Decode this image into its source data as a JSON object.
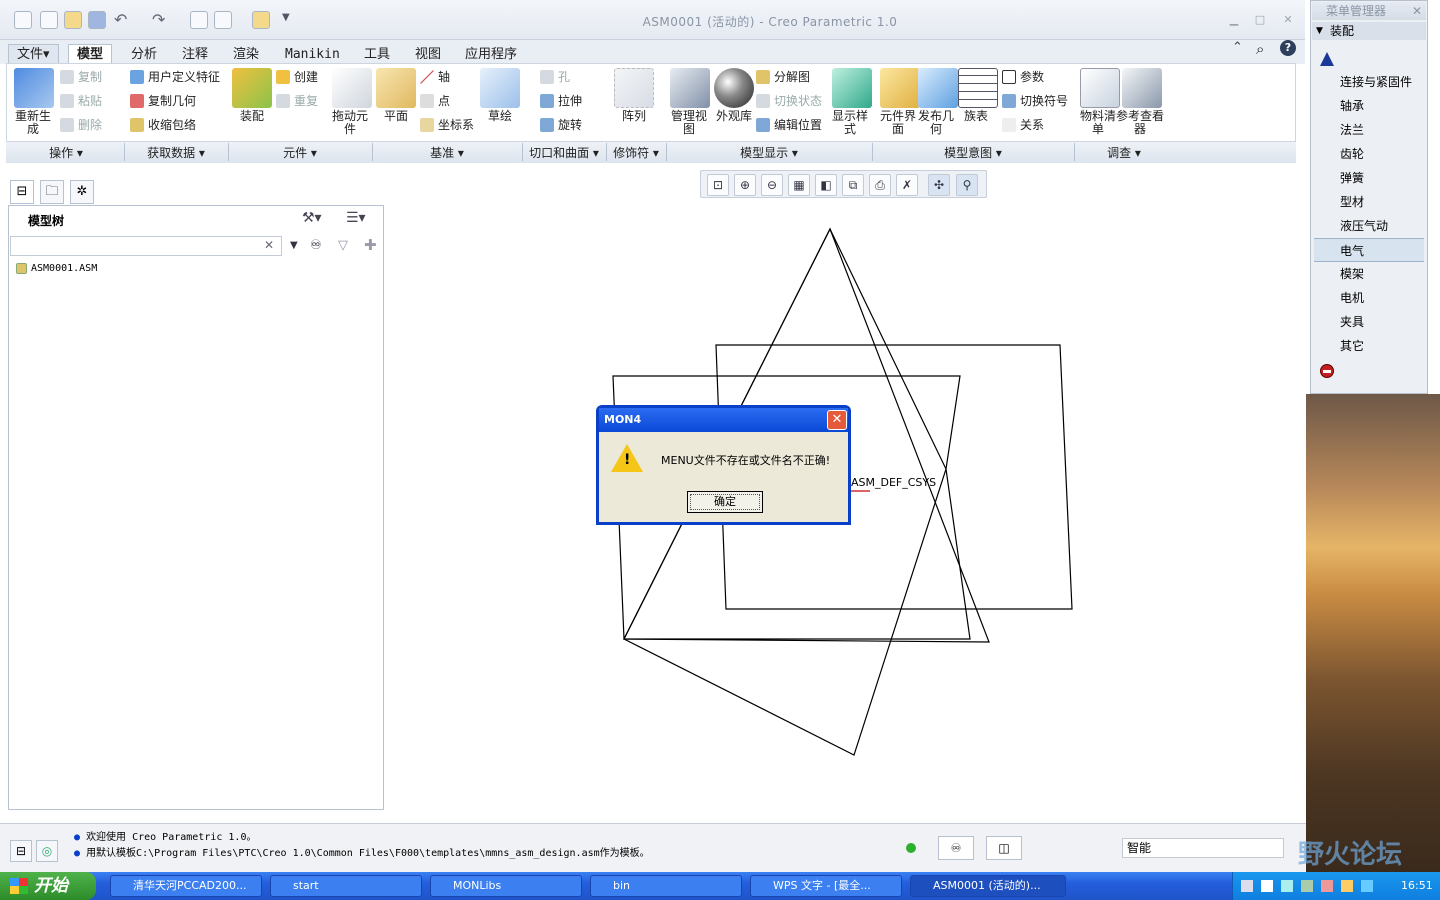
{
  "window": {
    "title": "ASM0001 (活动的) - Creo Parametric 1.0"
  },
  "tabs": [
    {
      "label": "文件",
      "suffix": "▾"
    },
    {
      "label": "模型"
    },
    {
      "label": "分析"
    },
    {
      "label": "注释"
    },
    {
      "label": "渲染"
    },
    {
      "label": "Manikin"
    },
    {
      "label": "工具"
    },
    {
      "label": "视图"
    },
    {
      "label": "应用程序"
    }
  ],
  "ribbon": {
    "regenerate": "重新生成",
    "copy": "复制",
    "paste": "粘贴",
    "delete": "删除",
    "udf": "用户定义特征",
    "copy_geom": "复制几何",
    "shrinkwrap": "收缩包络",
    "assemble": "装配",
    "create": "创建",
    "repeat": "重复",
    "drag": "拖动元件",
    "plane": "平面",
    "axis": "轴",
    "point": "点",
    "csys": "坐标系",
    "sketch": "草绘",
    "hole": "孔",
    "extrude": "拉伸",
    "revolve": "旋转",
    "pattern": "阵列",
    "manage_views": "管理视图",
    "appearance": "外观库",
    "explode": "分解图",
    "toggle_status": "切换状态",
    "edit_position": "编辑位置",
    "display_style": "显示样式",
    "component_interface": "元件界面",
    "publish_geom": "发布几何",
    "family_table": "族表",
    "params": "参数",
    "switch_symbols": "切换符号",
    "relations": "关系",
    "bom": "物料清单",
    "ref_viewer": "参考查看器"
  },
  "groups": [
    {
      "label": "操作"
    },
    {
      "label": "获取数据"
    },
    {
      "label": "元件"
    },
    {
      "label": "基准"
    },
    {
      "label": "切口和曲面"
    },
    {
      "label": "修饰符"
    },
    {
      "label": "模型显示"
    },
    {
      "label": "模型意图"
    },
    {
      "label": "调查"
    }
  ],
  "model_tree": {
    "title": "模型树",
    "search_value": "",
    "items": [
      {
        "label": "ASM0001.ASM"
      }
    ]
  },
  "graphics": {
    "csys_label": "ASM_DEF_CSYS"
  },
  "dialog": {
    "title": "MON4",
    "message": "MENU文件不存在或文件名不正确!",
    "ok": "确定"
  },
  "menu_manager": {
    "title": "菜单管理器",
    "subtitle": "装配",
    "items": [
      {
        "label": "连接与紧固件"
      },
      {
        "label": "轴承"
      },
      {
        "label": "法兰"
      },
      {
        "label": "齿轮"
      },
      {
        "label": "弹簧"
      },
      {
        "label": "型材"
      },
      {
        "label": "液压气动"
      },
      {
        "label": "电气",
        "selected": true
      },
      {
        "label": "模架"
      },
      {
        "label": "电机"
      },
      {
        "label": "夹具"
      },
      {
        "label": "其它"
      }
    ]
  },
  "status": {
    "messages": [
      "欢迎使用 Creo Parametric 1.0。",
      "用默认模板C:\\Program Files\\PTC\\Creo 1.0\\Common Files\\F000\\templates\\mmns_asm_design.asm作为模板。"
    ],
    "filter": "智能"
  },
  "taskbar": {
    "start": "开始",
    "tasks": [
      {
        "label": "清华天河PCCAD200..."
      },
      {
        "label": "start"
      },
      {
        "label": "MONLibs"
      },
      {
        "label": "bin"
      },
      {
        "label": "WPS 文字 - [最全..."
      },
      {
        "label": "ASM0001 (活动的)..."
      }
    ],
    "clock": "16:51"
  },
  "watermark": "野火论坛",
  "colors": {
    "accent": "#0a49d6",
    "taskbar": "#245edb",
    "start": "#2d8c2a"
  }
}
